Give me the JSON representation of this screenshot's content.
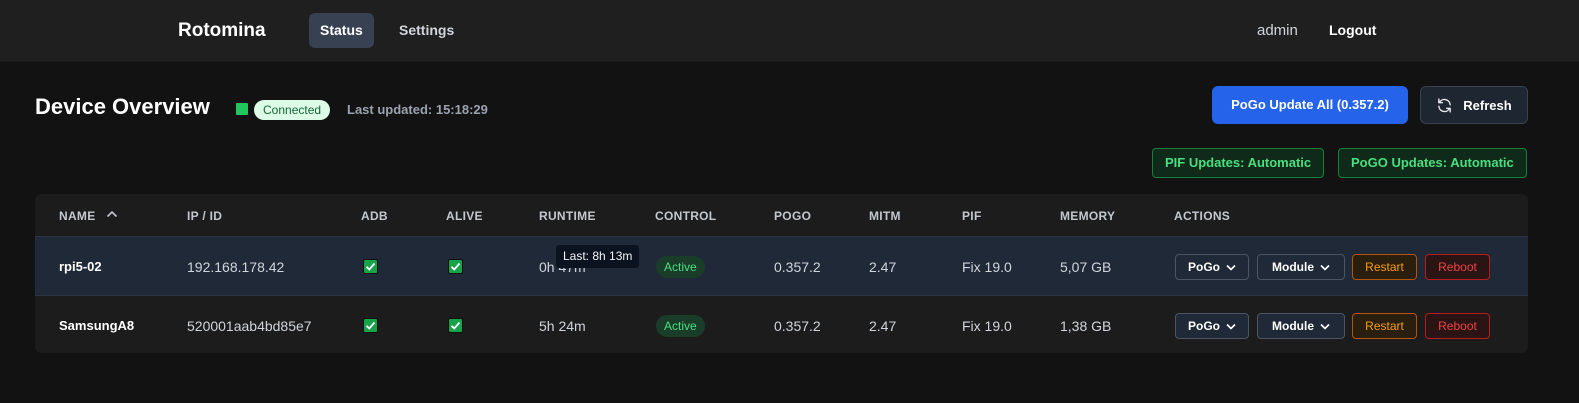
{
  "navbar": {
    "brand": "Rotomina",
    "tabs": [
      {
        "label": "Status",
        "active": true
      },
      {
        "label": "Settings",
        "active": false
      }
    ],
    "user": "admin",
    "logout": "Logout"
  },
  "header": {
    "title": "Device Overview",
    "connection_status": "Connected",
    "last_updated": "Last updated: 15:18:29",
    "update_all_button": "PoGo Update All (0.357.2)",
    "refresh_button": "Refresh",
    "pif_updates": "PIF Updates: Automatic",
    "pogo_updates": "PoGO Updates: Automatic"
  },
  "table": {
    "columns": [
      "NAME",
      "IP / ID",
      "ADB",
      "ALIVE",
      "RUNTIME",
      "CONTROL",
      "POGO",
      "MITM",
      "PIF",
      "MEMORY",
      "ACTIONS"
    ],
    "sort_column": "NAME",
    "sort_direction": "ascending",
    "rows": [
      {
        "name": "rpi5-02",
        "ip": "192.168.178.42",
        "adb": true,
        "alive": true,
        "runtime": "0h 47m",
        "control": "Active",
        "pogo": "0.357.2",
        "mitm": "2.47",
        "pif": "Fix 19.0",
        "memory": "5,07 GB",
        "actions": {
          "pogo": "PoGo",
          "module": "Module",
          "restart": "Restart",
          "reboot": "Reboot"
        }
      },
      {
        "name": "SamsungA8",
        "ip": "520001aab4bd85e7",
        "adb": true,
        "alive": true,
        "runtime": "5h 24m",
        "control": "Active",
        "pogo": "0.357.2",
        "mitm": "2.47",
        "pif": "Fix 19.0",
        "memory": "1,38 GB",
        "actions": {
          "pogo": "PoGo",
          "module": "Module",
          "restart": "Restart",
          "reboot": "Reboot"
        }
      }
    ]
  },
  "tooltip": "Last: 8h 13m",
  "colors": {
    "accent": "#2563eb",
    "success": "#22c55e",
    "warning": "#f59e0b",
    "danger": "#ef4444"
  }
}
